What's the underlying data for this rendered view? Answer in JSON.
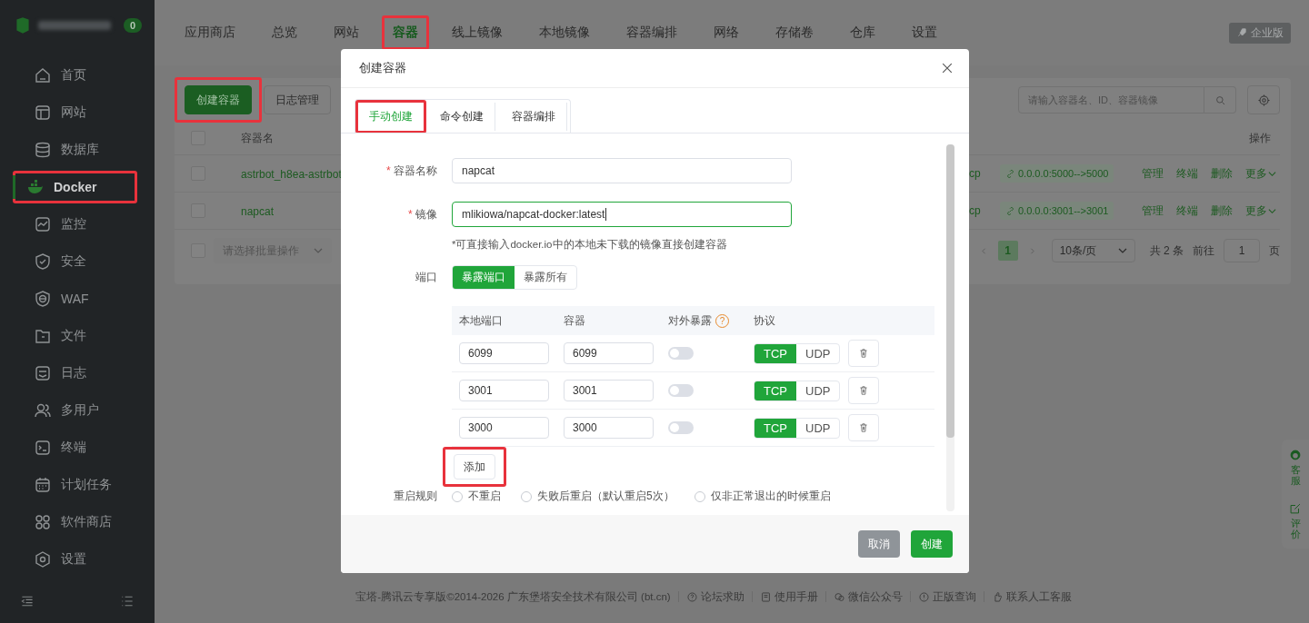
{
  "sidebar": {
    "badge": "0",
    "items": [
      {
        "label": "首页",
        "selected": false,
        "highlighted": false
      },
      {
        "label": "网站",
        "selected": false,
        "highlighted": false
      },
      {
        "label": "数据库",
        "selected": false,
        "highlighted": false
      },
      {
        "label": "Docker",
        "selected": true,
        "highlighted": true
      },
      {
        "label": "监控",
        "selected": false,
        "highlighted": false
      },
      {
        "label": "安全",
        "selected": false,
        "highlighted": false
      },
      {
        "label": "WAF",
        "selected": false,
        "highlighted": false
      },
      {
        "label": "文件",
        "selected": false,
        "highlighted": false
      },
      {
        "label": "日志",
        "selected": false,
        "highlighted": false
      },
      {
        "label": "多用户",
        "selected": false,
        "highlighted": false
      },
      {
        "label": "终端",
        "selected": false,
        "highlighted": false
      },
      {
        "label": "计划任务",
        "selected": false,
        "highlighted": false
      },
      {
        "label": "软件商店",
        "selected": false,
        "highlighted": false
      },
      {
        "label": "设置",
        "selected": false,
        "highlighted": false
      }
    ]
  },
  "top_nav": {
    "tabs": [
      {
        "label": "应用商店",
        "selected": false,
        "highlighted": false
      },
      {
        "label": "总览",
        "selected": false,
        "highlighted": false
      },
      {
        "label": "网站",
        "selected": false,
        "highlighted": false
      },
      {
        "label": "容器",
        "selected": true,
        "highlighted": true
      },
      {
        "label": "线上镜像",
        "selected": false,
        "highlighted": false
      },
      {
        "label": "本地镜像",
        "selected": false,
        "highlighted": false
      },
      {
        "label": "容器编排",
        "selected": false,
        "highlighted": false
      },
      {
        "label": "网络",
        "selected": false,
        "highlighted": false
      },
      {
        "label": "存储卷",
        "selected": false,
        "highlighted": false
      },
      {
        "label": "仓库",
        "selected": false,
        "highlighted": false
      },
      {
        "label": "设置",
        "selected": false,
        "highlighted": false
      }
    ],
    "edition": "企业版"
  },
  "toolbar": {
    "buttons": [
      {
        "label": "创建容器",
        "kind": "primary",
        "highlighted": true
      },
      {
        "label": "日志管理",
        "kind": "default",
        "highlighted": false
      }
    ],
    "search": {
      "placeholder": "请输入容器名、ID、容器镜像"
    }
  },
  "table": {
    "columns": [
      "容器名",
      "操作"
    ],
    "header_checked": false,
    "rows": [
      {
        "checked": false,
        "name": "astrbot_h8ea-astrbot",
        "column_3": "cp",
        "port": "0.0.0.0:5000-->5000",
        "actions": [
          "管理",
          "终端",
          "删除",
          "更多"
        ]
      },
      {
        "checked": false,
        "name": "napcat",
        "column_3": "cp",
        "port": "0.0.0.0:3001-->3001",
        "actions": [
          "管理",
          "终端",
          "删除",
          "更多"
        ]
      }
    ]
  },
  "pagination": {
    "batch_checked": false,
    "batch_placeholder": "请选择批量操作",
    "pages": [
      {
        "label": "1",
        "selected": true
      }
    ],
    "page_size": "10条/页",
    "total": "共 2 条",
    "goto_label": "前往",
    "goto_value": "1",
    "page_suffix": "页"
  },
  "dialog": {
    "title": "创建容器",
    "tabs": [
      {
        "label": "手动创建",
        "selected": true,
        "highlighted": true
      },
      {
        "label": "命令创建",
        "selected": false,
        "highlighted": false
      },
      {
        "label": "容器编排",
        "selected": false,
        "highlighted": false
      }
    ],
    "fields": [
      {
        "mark": "*",
        "label": "容器名称",
        "value": "napcat",
        "focused": false
      },
      {
        "mark": "*",
        "label": "镜像",
        "value": "mlikiowa/napcat-docker:latest",
        "focused": true
      }
    ],
    "hint": "*可直接输入docker.io中的本地未下载的镜像直接创建容器",
    "port": {
      "label": "端口",
      "modes": [
        {
          "label": "暴露端口",
          "selected": true
        },
        {
          "label": "暴露所有",
          "selected": false
        }
      ],
      "columns": [
        {
          "label": "本地端口"
        },
        {
          "label": "容器"
        },
        {
          "label": "对外暴露",
          "help": "?"
        },
        {
          "label": "协议"
        }
      ],
      "rows": [
        {
          "local": "6099",
          "container": "6099",
          "exposed": false,
          "protocols": [
            {
              "label": "TCP",
              "selected": true
            },
            {
              "label": "UDP",
              "selected": false
            }
          ]
        },
        {
          "local": "3001",
          "container": "3001",
          "exposed": false,
          "protocols": [
            {
              "label": "TCP",
              "selected": true
            },
            {
              "label": "UDP",
              "selected": false
            }
          ]
        },
        {
          "local": "3000",
          "container": "3000",
          "exposed": false,
          "protocols": [
            {
              "label": "TCP",
              "selected": true
            },
            {
              "label": "UDP",
              "selected": false
            }
          ]
        }
      ],
      "add_button": {
        "label": "添加",
        "highlighted": true
      }
    },
    "restart": {
      "label": "重启规则",
      "options": [
        {
          "label": "不重启",
          "selected": false
        },
        {
          "label": "失败后重启（默认重启5次）",
          "selected": false
        },
        {
          "label": "仅非正常退出的时候重启",
          "selected": false
        }
      ]
    },
    "buttons": [
      {
        "label": "取消",
        "kind": "secondary"
      },
      {
        "label": "创建",
        "kind": "primary"
      }
    ]
  },
  "float_panel": [
    {
      "label": "客服"
    },
    {
      "label": "评价"
    }
  ],
  "footer": {
    "copyright": "宝塔-腾讯云专享版©2014-2026 广东堡塔安全技术有限公司 (bt.cn)",
    "links": [
      "论坛求助",
      "使用手册",
      "微信公众号",
      "正版查询",
      "联系人工客服"
    ]
  }
}
